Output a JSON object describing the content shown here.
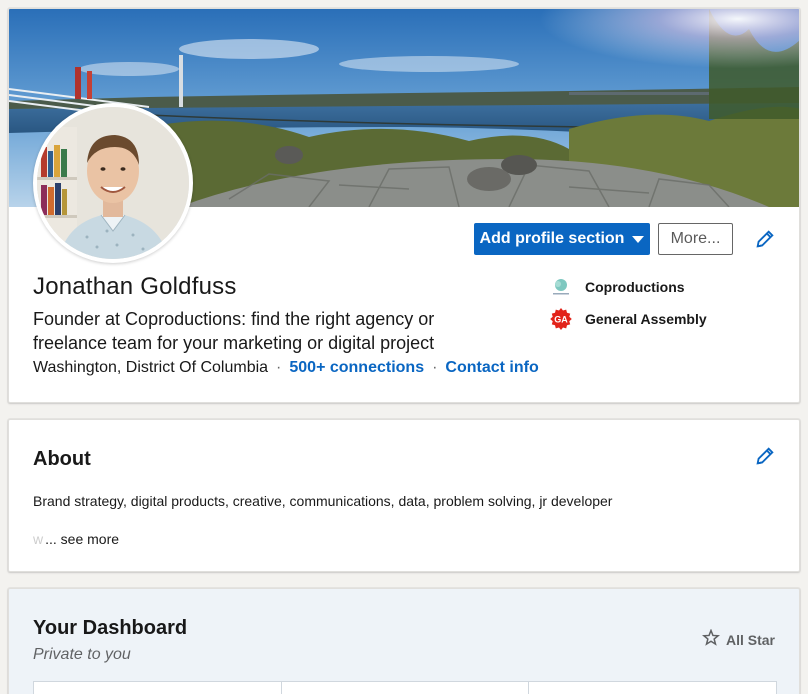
{
  "profile": {
    "name": "Jonathan Goldfuss",
    "headline": "Founder at Coproductions: find the right agency or freelance team for your marketing or digital project",
    "location": "Washington, District Of Columbia",
    "separator": "·",
    "connections": "500+ connections",
    "contact_info": "Contact info",
    "add_section_label": "Add profile section",
    "more_label": "More...",
    "companies": [
      {
        "name": "Coproductions",
        "icon": "coproductions-logo"
      },
      {
        "name": "General Assembly",
        "icon": "general-assembly-logo"
      }
    ]
  },
  "about": {
    "title": "About",
    "text": "Brand strategy, digital products, creative, communications, data, problem solving, jr developer",
    "fade_text": "w",
    "see_more": "... see more"
  },
  "dashboard": {
    "title": "Your Dashboard",
    "subtitle": "Private to you",
    "badge": "All Star",
    "badge_icon": "star-icon"
  },
  "colors": {
    "accent": "#0a66c2",
    "background": "#f3f2ef",
    "dashboard_bg": "#eef3f8",
    "ga_red": "#e2231a"
  }
}
